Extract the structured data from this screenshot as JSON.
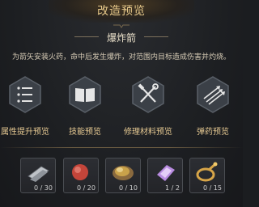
{
  "header": {
    "title": "改造预览"
  },
  "weapon": {
    "name": "爆炸箭",
    "description": "为箭矢安装火药，命中后发生爆炸，对范围内目标造成伤害并灼烧。"
  },
  "actions": [
    {
      "label": "属性提升预览",
      "icon": "list-icon"
    },
    {
      "label": "技能预览",
      "icon": "book-icon"
    },
    {
      "label": "修理材料预览",
      "icon": "tools-icon"
    },
    {
      "label": "弹药预览",
      "icon": "arrows-icon"
    }
  ],
  "materials": [
    {
      "count": "0 / 30",
      "icon": "metal-ingot-icon",
      "color": "#bfc3c8"
    },
    {
      "count": "0 / 20",
      "icon": "red-orb-icon",
      "color": "#c4453a"
    },
    {
      "count": "0 / 10",
      "icon": "gold-ore-icon",
      "color": "#c9a24a"
    },
    {
      "count": "1 / 2",
      "icon": "purple-crystal-icon",
      "color": "#b88be0"
    },
    {
      "count": "0 / 15",
      "icon": "gold-ring-icon",
      "color": "#d7a548"
    }
  ],
  "colors": {
    "accent": "#e7c98a",
    "button_bg": "#3b4047"
  }
}
